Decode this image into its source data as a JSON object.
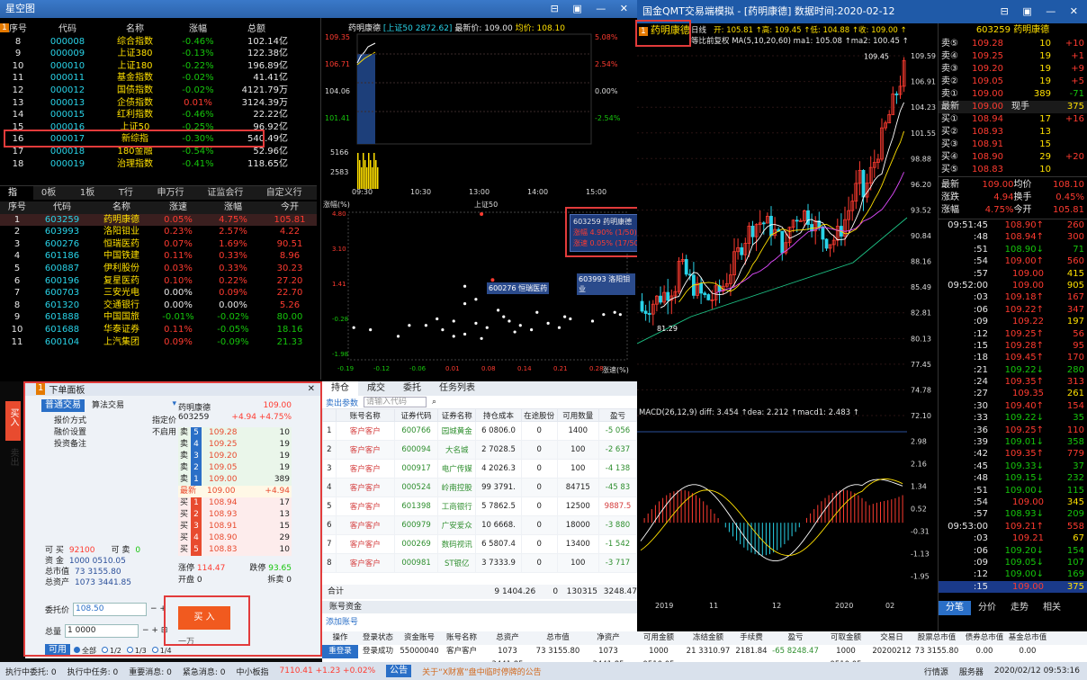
{
  "left_window": {
    "title": "星空图",
    "badge": "1",
    "index_header": [
      "序号",
      "代码",
      "名称",
      "涨幅",
      "总额"
    ],
    "index_rows": [
      [
        "8",
        "000008",
        "综合指数",
        "-0.46%",
        "102.14亿"
      ],
      [
        "9",
        "000009",
        "上证380",
        "-0.13%",
        "122.38亿"
      ],
      [
        "10",
        "000010",
        "上证180",
        "-0.22%",
        "196.89亿"
      ],
      [
        "11",
        "000011",
        "基金指数",
        "-0.02%",
        "41.41亿"
      ],
      [
        "12",
        "000012",
        "国债指数",
        "-0.02%",
        "4121.79万"
      ],
      [
        "13",
        "000013",
        "企债指数",
        "0.01%",
        "3124.39万"
      ],
      [
        "14",
        "000015",
        "红利指数",
        "-0.46%",
        "22.22亿"
      ],
      [
        "15",
        "000016",
        "上证50",
        "-0.25%",
        "96.92亿"
      ],
      [
        "16",
        "000017",
        "新综指",
        "-0.30%",
        "540.49亿"
      ],
      [
        "17",
        "000018",
        "180金融",
        "-0.54%",
        "52.96亿"
      ],
      [
        "18",
        "000019",
        "治理指数",
        "-0.41%",
        "118.65亿"
      ]
    ],
    "index_tabs": [
      "指数",
      "0板块",
      "1板块",
      "T行业",
      "申万行业",
      "证监会行业",
      "自定义行业"
    ],
    "stock_header": [
      "序号",
      "代码",
      "名称",
      "涨速",
      "涨幅",
      "今开"
    ],
    "stock_rows": [
      [
        "1",
        "603259",
        "药明康德",
        "0.05%",
        "4.75%",
        "105.81"
      ],
      [
        "2",
        "603993",
        "洛阳钼业",
        "0.23%",
        "2.57%",
        "4.22"
      ],
      [
        "3",
        "600276",
        "恒瑞医药",
        "0.07%",
        "1.69%",
        "90.51"
      ],
      [
        "4",
        "601186",
        "中国铁建",
        "0.11%",
        "0.33%",
        "8.96"
      ],
      [
        "5",
        "600887",
        "伊利股份",
        "0.03%",
        "0.33%",
        "30.23"
      ],
      [
        "6",
        "600196",
        "复星医药",
        "0.10%",
        "0.22%",
        "27.20"
      ],
      [
        "7",
        "600703",
        "三安光电",
        "0.00%",
        "0.09%",
        "22.70"
      ],
      [
        "8",
        "601320",
        "交通银行",
        "0.00%",
        "0.00%",
        "5.26"
      ],
      [
        "9",
        "601888",
        "中国国旅",
        "-0.01%",
        "-0.02%",
        "80.00"
      ],
      [
        "10",
        "601688",
        "华泰证券",
        "0.11%",
        "-0.05%",
        "18.16"
      ],
      [
        "11",
        "600104",
        "上汽集团",
        "0.09%",
        "-0.09%",
        "21.33"
      ]
    ]
  },
  "mini_chart": {
    "name": "药明康德",
    "index_label": "[上证50 2872.62]",
    "latest": "最新价: 109.00",
    "avg": "均价: 108.10",
    "ylabels": [
      "109.35",
      "106.71",
      "104.06",
      "101.41"
    ],
    "pct": [
      "5.08%",
      "2.54%",
      "0.00%",
      "-2.54%"
    ],
    "vol": [
      "5166",
      "2583"
    ],
    "times": [
      "09:30",
      "10:30",
      "13:00",
      "14:00",
      "15:00"
    ]
  },
  "scatter": {
    "title": "上证50",
    "ylabel": "涨幅(%)",
    "xlabel": "涨速(%)",
    "yticks": [
      "4.80",
      "3.10",
      "1.41",
      "-0.28",
      "-1.98"
    ],
    "xticks": [
      "-0.19",
      "-0.12",
      "-0.06",
      "0.01",
      "0.08",
      "0.14",
      "0.21",
      "0.28"
    ],
    "tip_title": "603259 药明康德",
    "tip_l1": "涨幅 4.90% (1/50)",
    "tip_l2": "涨速 0.05% (17/50)",
    "label_a": "600276 恒瑞医药",
    "label_b": "603993 洛阳钼业"
  },
  "order_panel": {
    "title": "下单面板",
    "side_buy": "买入",
    "side_sell": "卖出",
    "mode": "普通交易",
    "algo": "算法交易",
    "f1_label": "报价方式",
    "f1_val": "指定价",
    "f2_label": "融价设置",
    "f2_val": "不启用",
    "f3_label": "投资备注",
    "stock_name": "药明康德",
    "stock_price": "109.00",
    "stock_code": "603259",
    "stock_chg": "+4.94 +4.75%",
    "asks": [
      [
        "卖",
        "5",
        "109.28",
        "10"
      ],
      [
        "卖",
        "4",
        "109.25",
        "19"
      ],
      [
        "卖",
        "3",
        "109.20",
        "19"
      ],
      [
        "卖",
        "2",
        "109.05",
        "19"
      ],
      [
        "卖",
        "1",
        "109.00",
        "389"
      ]
    ],
    "latest_l": "最新",
    "latest_v": "109.00",
    "latest_c": "+4.94",
    "bids": [
      [
        "买",
        "1",
        "108.94",
        "17"
      ],
      [
        "买",
        "2",
        "108.93",
        "13"
      ],
      [
        "买",
        "3",
        "108.91",
        "15"
      ],
      [
        "买",
        "4",
        "108.90",
        "29"
      ],
      [
        "买",
        "5",
        "108.83",
        "10"
      ]
    ],
    "limit_up_l": "涨停",
    "limit_up": "114.47",
    "limit_dn_l": "跌停",
    "limit_dn": "93.65",
    "open_l": "开盘",
    "open": "0",
    "open2_l": "拆卖",
    "open2": "0",
    "can_buy_l": "可 买",
    "can_buy": "92100",
    "can_sell_l": "可 卖",
    "can_sell": "0",
    "cash_l": "资 金",
    "cash": "1000 0510.05",
    "mkt_l": "总市值",
    "mkt": "73 3155.80",
    "assets_l": "总资产",
    "assets": "1073 3441.85",
    "price_l": "委托价",
    "price": "108.50",
    "qty_l": "总量",
    "qty": "1 0000",
    "qty_hint": "一万",
    "buy_btn": "买 入",
    "use_l": "可用",
    "radios": [
      "全部",
      "1/2",
      "1/3",
      "1/4"
    ]
  },
  "positions": {
    "tabs": [
      "持仓",
      "成交",
      "委托",
      "任务列表"
    ],
    "export": "卖出参数",
    "search_ph": "请输入代码",
    "header": [
      "",
      "账号名称",
      "证券代码",
      "证券名称",
      "持仓成本",
      "在途股份",
      "可用数量",
      "盈亏"
    ],
    "rows": [
      [
        "1",
        "客户客户",
        "600766",
        "园城黄金",
        "6 0806.0",
        "0",
        "1400",
        "-5 056"
      ],
      [
        "2",
        "客户客户",
        "600094",
        "大名城",
        "2 7028.5",
        "0",
        "100",
        "-2 637"
      ],
      [
        "3",
        "客户客户",
        "000917",
        "电广传媒",
        "4 2026.3",
        "0",
        "100",
        "-4 138"
      ],
      [
        "4",
        "客户客户",
        "000524",
        "岭南控股",
        "99 3791.",
        "0",
        "84715",
        "-45 83"
      ],
      [
        "5",
        "客户客户",
        "601398",
        "工商银行",
        "5 7862.5",
        "0",
        "12500",
        "9887.5"
      ],
      [
        "6",
        "客户客户",
        "600979",
        "广安爱众",
        "10 6668.",
        "0",
        "18000",
        "-3 880"
      ],
      [
        "7",
        "客户客户",
        "000269",
        "数码视讯",
        "6 5807.4",
        "0",
        "13400",
        "-1 542"
      ],
      [
        "8",
        "客户客户",
        "000981",
        "ST银亿",
        "3 7333.9",
        "0",
        "100",
        "-3 717"
      ]
    ],
    "total_l": "合计",
    "total": [
      "9 1404.26",
      "0",
      "130315",
      "3248.47"
    ],
    "acct_tab": "账号资金",
    "add_acct": "添加账号",
    "acct_header": [
      "操作",
      "登录状态",
      "资金账号",
      "账号名称",
      "总资产",
      "总市值",
      "净资产",
      "可用金额",
      "冻结金额",
      "手续费",
      "盈亏",
      "可取金额",
      "交易日",
      "股票总市值",
      "债券总市值",
      "基金总市值"
    ],
    "acct_row": [
      "重登录",
      "登录成功",
      "55000040",
      "客户客户",
      "1073 3441.85",
      "73 3155.80",
      "1073 3441.85",
      "1000 0510.05",
      "21 3310.97",
      "2181.84",
      "-65 8248.47",
      "1000 0510.05",
      "20200212",
      "73 3155.80",
      "0.00",
      "0.00"
    ]
  },
  "right_window": {
    "title": "国金QMT交易端模拟 - [药明康德]  数据时间:2020-02-12",
    "stock": "药明康德",
    "badge": "1",
    "daily": "日线",
    "adj": "等比前复权",
    "ohlc": "开: 105.81 ↑高: 109.45 ↑低: 104.88 ↑收: 109.00 ↑",
    "ma": "MA(5,10,20,60)  ma1: 105.08 ↑ma2: 100.45 ↑",
    "ylabels": [
      "109.59",
      "106.91",
      "104.23",
      "101.55",
      "98.88",
      "96.20",
      "93.52",
      "90.84",
      "88.16",
      "85.49",
      "82.81",
      "80.13",
      "77.45",
      "74.78",
      "72.10"
    ],
    "hi_mark": "109.45",
    "lo_mark": "81.29",
    "macd": "MACD(26,12,9)  diff: 3.454 ↑dea: 2.212 ↑macd1: 2.483 ↑",
    "macd_y": [
      "2.98",
      "2.16",
      "1.34",
      "0.52",
      "-0.31",
      "-1.13",
      "-1.95"
    ],
    "xlabels": [
      "2019",
      "11",
      "12",
      "2020",
      "02"
    ]
  },
  "quote": {
    "code": "603259",
    "name": "药明康德",
    "asks": [
      [
        "卖⑤",
        "109.28",
        "10",
        "+10"
      ],
      [
        "卖④",
        "109.25",
        "19",
        "+1"
      ],
      [
        "卖③",
        "109.20",
        "19",
        "+9"
      ],
      [
        "卖②",
        "109.05",
        "19",
        "+5"
      ],
      [
        "卖①",
        "109.00",
        "389",
        "-71"
      ]
    ],
    "latest_l": "最新",
    "latest": "109.00",
    "latest_tag": "现手",
    "latest_vol": "375",
    "bids": [
      [
        "买①",
        "108.94",
        "17",
        "+16"
      ],
      [
        "买②",
        "108.93",
        "13",
        ""
      ],
      [
        "买③",
        "108.91",
        "15",
        ""
      ],
      [
        "买④",
        "108.90",
        "29",
        "+20"
      ],
      [
        "买⑤",
        "108.83",
        "10",
        ""
      ]
    ],
    "stats": [
      [
        "最新",
        "109.00",
        "均价",
        "108.10"
      ],
      [
        "涨跌",
        "4.94",
        "换手",
        "0.45%"
      ],
      [
        "涨幅",
        "4.75%",
        "今开",
        "105.81"
      ]
    ],
    "ticks": [
      [
        "09:51:45",
        "108.90↑",
        "260"
      ],
      [
        ":48",
        "108.94↑",
        "300"
      ],
      [
        ":51",
        "108.90↓",
        "71"
      ],
      [
        ":54",
        "109.00↑",
        "560"
      ],
      [
        ":57",
        "109.00",
        "415"
      ],
      [
        "09:52:00",
        "109.00",
        "905"
      ],
      [
        ":03",
        "109.18↑",
        "167"
      ],
      [
        ":06",
        "109.22↑",
        "347"
      ],
      [
        ":09",
        "109.22",
        "197"
      ],
      [
        ":12",
        "109.25↑",
        "56"
      ],
      [
        ":15",
        "109.28↑",
        "95"
      ],
      [
        ":18",
        "109.45↑",
        "170"
      ],
      [
        ":21",
        "109.22↓",
        "280"
      ],
      [
        ":24",
        "109.35↑",
        "313"
      ],
      [
        ":27",
        "109.35",
        "261"
      ],
      [
        ":30",
        "109.40↑",
        "154"
      ],
      [
        ":33",
        "109.22↓",
        "35"
      ],
      [
        ":36",
        "109.25↑",
        "110"
      ],
      [
        ":39",
        "109.01↓",
        "358"
      ],
      [
        ":42",
        "109.35↑",
        "779"
      ],
      [
        ":45",
        "109.33↓",
        "37"
      ],
      [
        ":48",
        "109.15↓",
        "232"
      ],
      [
        ":51",
        "109.00↓",
        "115"
      ],
      [
        ":54",
        "109.00",
        "345"
      ],
      [
        ":57",
        "108.93↓",
        "209"
      ],
      [
        "09:53:00",
        "109.21↑",
        "558"
      ],
      [
        ":03",
        "109.21",
        "67"
      ],
      [
        ":06",
        "109.20↓",
        "154"
      ],
      [
        ":09",
        "109.05↓",
        "107"
      ],
      [
        ":12",
        "109.00↓",
        "169"
      ],
      [
        ":15",
        "109.00",
        "375"
      ]
    ],
    "tabs": [
      "分笔",
      "分价",
      "走势",
      "相关"
    ]
  },
  "status": {
    "items": [
      "执行中委托: 0",
      "执行中任务: 0",
      "重要消息: 0",
      "紧急消息: 0",
      "中小板指"
    ],
    "sme": "7110.41  +1.23  +0.02%",
    "notice_l": "公告",
    "notice": "关于“X财富”盘中临时停牌的公告",
    "right_items": [
      "行情源",
      "服务器"
    ],
    "time": "2020/02/12  09:53:16"
  }
}
